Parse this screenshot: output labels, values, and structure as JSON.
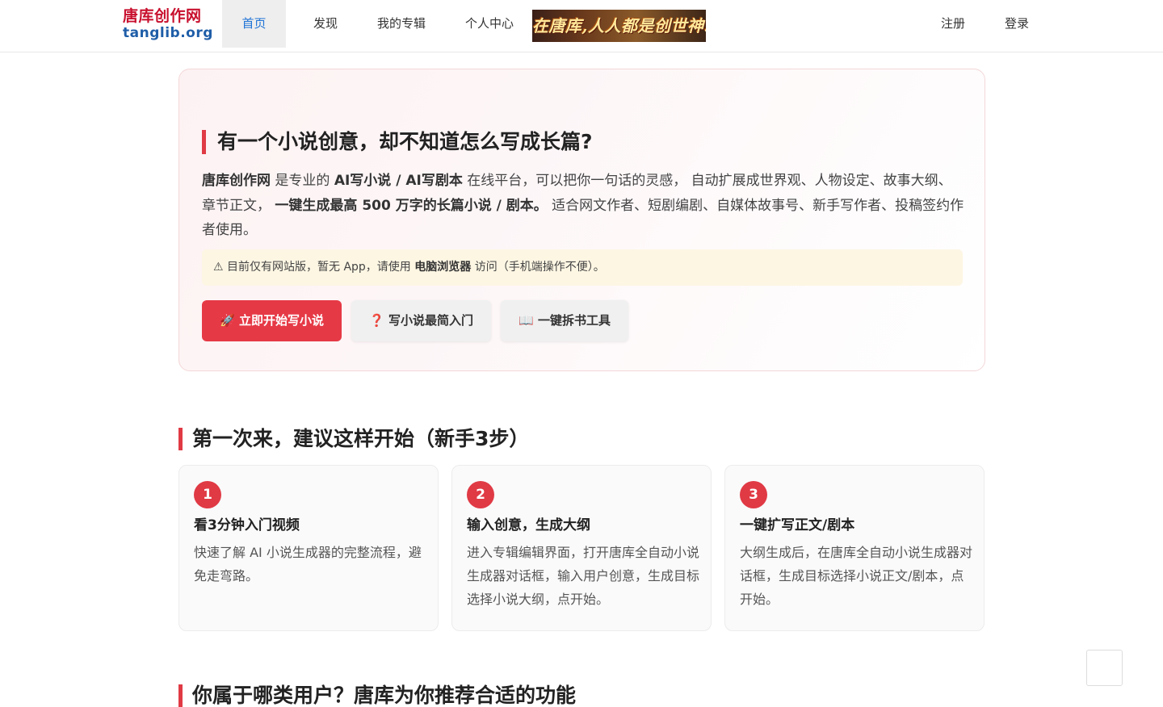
{
  "header": {
    "logo_cn": "唐库创作网",
    "logo_en": "tanglib.org",
    "nav": [
      "首页",
      "发现",
      "我的专辑",
      "个人中心"
    ],
    "banner_text": "在唐库,人人都是创世神!",
    "register": "注册",
    "login": "登录"
  },
  "hero": {
    "title": "有一个小说创意，却不知道怎么写成长篇?",
    "desc_1": "唐库创作网",
    "desc_2": " 是专业的 ",
    "desc_3": "AI写小说 / AI写剧本",
    "desc_4": " 在线平台，可以把你一句话的灵感， 自动扩展成世界观、人物设定、故事大纲、章节正文， ",
    "desc_5": "一键生成最高 500 万字的长篇小说 / 剧本。",
    "desc_6": " 适合网文作者、短剧编剧、自媒体故事号、新手写作者、投稿签约作者使用。",
    "notice_1": "⚠ 目前仅有网站版，暂无 App，请使用 ",
    "notice_2": "电脑浏览器",
    "notice_3": " 访问（手机端操作不便）。",
    "btn_start": "🚀 立即开始写小说",
    "btn_guide": "❓ 写小说最简入门",
    "btn_tool": "📖 一键拆书工具"
  },
  "steps_section": {
    "title": "第一次来，建议这样开始（新手3步）",
    "steps": [
      {
        "num": "1",
        "title": "看3分钟入门视频",
        "text": "快速了解 AI 小说生成器的完整流程，避免走弯路。"
      },
      {
        "num": "2",
        "title": "输入创意，生成大纲",
        "text": "进入专辑编辑界面，打开唐库全自动小说生成器对话框，输入用户创意，生成目标选择小说大纲，点开始。"
      },
      {
        "num": "3",
        "title": "一键扩写正文/剧本",
        "text": "大纲生成后，在唐库全自动小说生成器对话框，生成目标选择小说正文/剧本，点开始。"
      }
    ]
  },
  "next_section": {
    "title": "你属于哪类用户？唐库为你推荐合适的功能"
  }
}
